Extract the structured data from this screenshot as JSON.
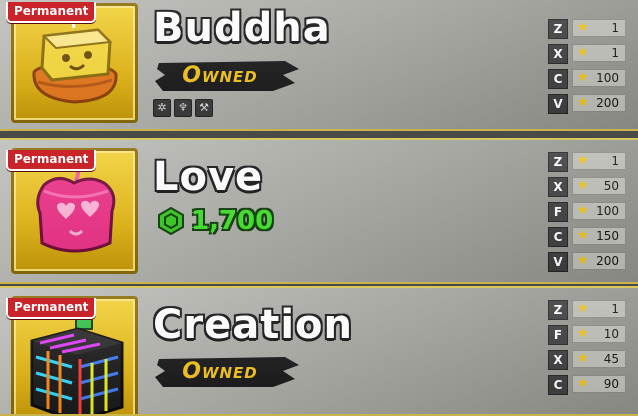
{
  "rows": [
    {
      "badge": "Permanent",
      "name": "Buddha",
      "status": "Owned",
      "moves": [
        {
          "key": "Z",
          "level": "1"
        },
        {
          "key": "X",
          "level": "1"
        },
        {
          "key": "C",
          "level": "100"
        },
        {
          "key": "V",
          "level": "200"
        }
      ]
    },
    {
      "badge": "Permanent",
      "name": "Love",
      "price": "1,700",
      "moves": [
        {
          "key": "Z",
          "level": "1"
        },
        {
          "key": "X",
          "level": "50"
        },
        {
          "key": "F",
          "level": "100"
        },
        {
          "key": "C",
          "level": "150"
        },
        {
          "key": "V",
          "level": "200"
        }
      ]
    },
    {
      "badge": "Permanent",
      "name": "Creation",
      "status": "Owned",
      "moves": [
        {
          "key": "Z",
          "level": "1"
        },
        {
          "key": "F",
          "level": "10"
        },
        {
          "key": "X",
          "level": "45"
        },
        {
          "key": "C",
          "level": "90"
        }
      ]
    }
  ],
  "colors": {
    "frame_gold": "#e2b512",
    "badge_red": "#c8242a",
    "owned_gold": "#f4c21b",
    "price_green": "#3fe02a"
  },
  "icons": [
    "buddha-fruit-icon",
    "love-fruit-icon",
    "creation-fruit-icon",
    "robux-icon",
    "star-icon"
  ]
}
